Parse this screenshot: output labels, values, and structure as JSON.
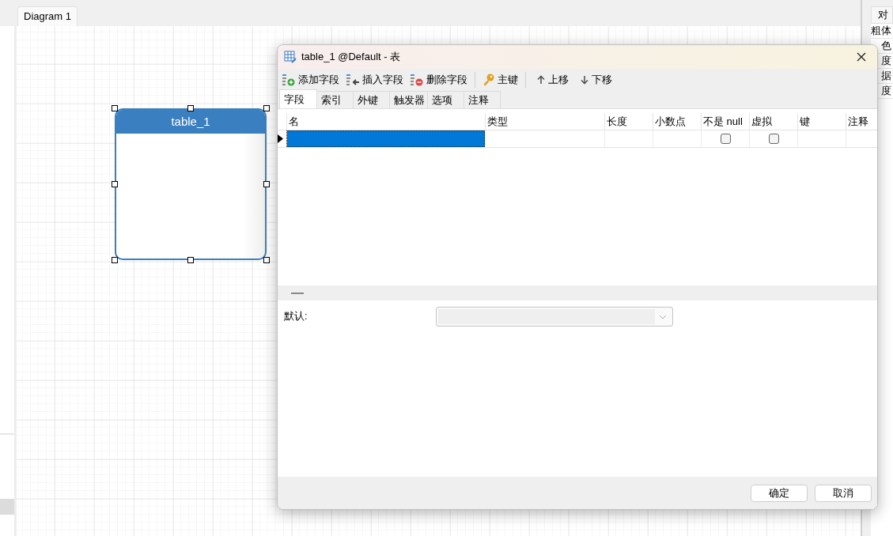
{
  "canvas_tab": {
    "label": "Diagram 1",
    "selected": true
  },
  "entity": {
    "title": "table_1",
    "selected": true
  },
  "side_panel": {
    "tab": "对",
    "rows": [
      "粗体",
      "色",
      "度",
      "据",
      "度"
    ]
  },
  "dialog": {
    "title": "table_1 @Default - 表",
    "toolbar": [
      {
        "label": "添加字段",
        "kind": "add"
      },
      {
        "label": "插入字段",
        "kind": "insert"
      },
      {
        "label": "删除字段",
        "kind": "delete"
      },
      {
        "label": "主键",
        "kind": "key"
      },
      {
        "label": "上移",
        "kind": "up"
      },
      {
        "label": "下移",
        "kind": "down"
      }
    ],
    "tabs": [
      {
        "label": "字段",
        "selected": true
      },
      {
        "label": "索引",
        "selected": false
      },
      {
        "label": "外键",
        "selected": false
      },
      {
        "label": "触发器",
        "selected": false
      },
      {
        "label": "选项",
        "selected": false
      },
      {
        "label": "注释",
        "selected": false
      }
    ],
    "columns": [
      "名",
      "类型",
      "长度",
      "小数点",
      "不是 null",
      "虚拟",
      "键",
      "注释"
    ],
    "rows": [
      {
        "current": true,
        "cells": [
          {
            "kind": "text",
            "selected": true
          },
          {
            "kind": "text",
            "selected": false
          },
          {
            "kind": "text",
            "selected": false
          },
          {
            "kind": "text",
            "selected": false
          },
          {
            "kind": "checkbox",
            "checked": false
          },
          {
            "kind": "checkbox",
            "checked": false
          },
          {
            "kind": "text",
            "selected": false
          },
          {
            "kind": "text",
            "selected": false
          }
        ]
      }
    ],
    "default_field": {
      "label": "默认:",
      "disabled": true
    },
    "buttons": [
      "确定",
      "取消"
    ]
  }
}
